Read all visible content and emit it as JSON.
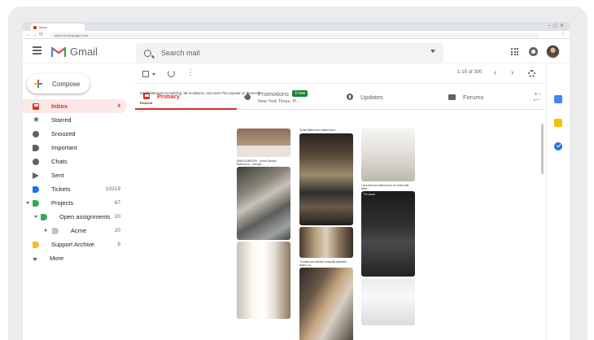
{
  "browser": {
    "tab_title": "Inbox",
    "url": "https://mail.google.com"
  },
  "header": {
    "app_name": "Gmail",
    "search_placeholder": "Search mail"
  },
  "compose_label": "Compose",
  "sidebar": {
    "items": [
      {
        "label": "Inbox",
        "count": "4",
        "icon": "inbox-icon"
      },
      {
        "label": "Starred",
        "count": "",
        "icon": "star-icon"
      },
      {
        "label": "Snoozed",
        "count": "",
        "icon": "clock-icon"
      },
      {
        "label": "Important",
        "count": "",
        "icon": "important-icon"
      },
      {
        "label": "Chats",
        "count": "",
        "icon": "chat-icon"
      },
      {
        "label": "Sent",
        "count": "",
        "icon": "send-icon"
      },
      {
        "label": "Tickets",
        "count": "10219",
        "icon": "label-icon"
      },
      {
        "label": "Projects",
        "count": "67",
        "icon": "label-icon"
      },
      {
        "label": "Open assignments",
        "count": "20",
        "icon": "label-icon"
      },
      {
        "label": "Acme",
        "count": "20",
        "icon": "label-icon"
      },
      {
        "label": "Support Archive",
        "count": "8",
        "icon": "label-icon"
      },
      {
        "label": "More",
        "count": "",
        "icon": "chevron-down-icon"
      }
    ]
  },
  "toolbar": {
    "range": "1-15 of 300"
  },
  "tabs": {
    "primary": "Primary",
    "promotions": "Promotions",
    "promotions_badge": "3 new",
    "promotions_sub": "New York Times, Pi...",
    "updates": "Updates",
    "forums": "Forums"
  },
  "message": {
    "preview": "Small bathroom remodeling, tile sculptures, and more Pins popular on Pinterest",
    "sender": "Pinterest"
  },
  "pins": {
    "cap_1": "BIANCA MINTER... mirror Fashion Bathrooms... concept...",
    "title_1": "Small Bathroom Makeovers",
    "cap_2": "To make your kitchen a visually attractive space, yo...",
    "cap_3": "I love that one bathroom in our home that featu...",
    "overlay_3": "Pin saved"
  },
  "colors": {
    "accent_red": "#d93025",
    "promo_badge": "#188038"
  }
}
